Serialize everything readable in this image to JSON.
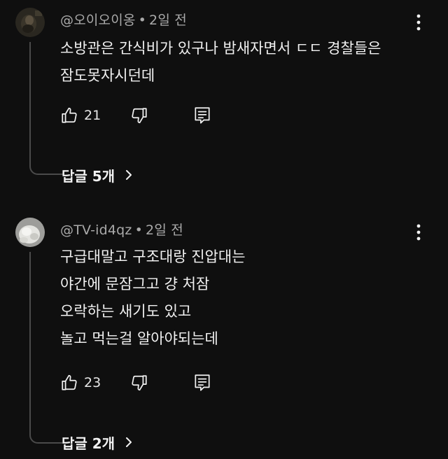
{
  "comments": [
    {
      "author": "@오이오이옹",
      "separator": "•",
      "time": "2일 전",
      "lines": [
        "소방관은 간식비가 있구나 밤새자면서 ㄷㄷ  경찰들은",
        "잠도못자시던데"
      ],
      "likes": "21",
      "replies_label": "답글 5개"
    },
    {
      "author": "@TV-id4qz",
      "separator": "•",
      "time": "2일 전",
      "lines": [
        "구급대말고 구조대랑 진압대는",
        "야간에 문잠그고 걍 처잠",
        "오락하는 새기도 있고",
        "놀고 먹는걸 알아야되는데"
      ],
      "likes": "23",
      "replies_label": "답글 2개"
    }
  ],
  "icons": {
    "like": "thumb-up-outline-icon",
    "dislike": "thumb-down-outline-icon",
    "reply": "reply-comment-icon",
    "more": "vertical-dots-icon",
    "expand": "chevron-right-icon"
  },
  "colors": {
    "background": "#0f0f0f",
    "text": "#f1f1f1",
    "meta": "#aaaaaa",
    "thread_line": "#4a4a4a"
  }
}
